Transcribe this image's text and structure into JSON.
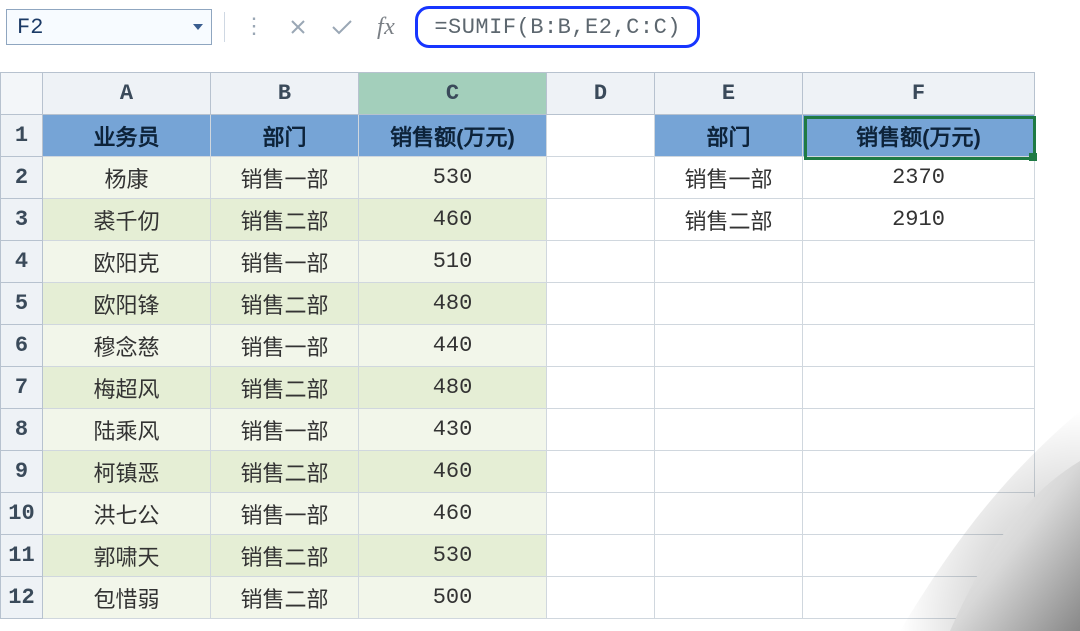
{
  "namebox": {
    "value": "F2"
  },
  "formula_bar": {
    "formula": "=SUMIF(B:B,E2,C:C)"
  },
  "icons": {
    "dropdown": "chevron-down",
    "cancel": "x",
    "confirm": "check",
    "fx": "fx"
  },
  "columns": [
    "A",
    "B",
    "C",
    "D",
    "E",
    "F"
  ],
  "rows": [
    "1",
    "2",
    "3",
    "4",
    "5",
    "6",
    "7",
    "8",
    "9",
    "10",
    "11",
    "12"
  ],
  "headers": {
    "A1": "业务员",
    "B1": "部门",
    "C1": "销售额(万元)",
    "E1": "部门",
    "F1": "销售额(万元)"
  },
  "left_table": [
    {
      "name": "杨康",
      "dept": "销售一部",
      "amount": "530"
    },
    {
      "name": "裘千仞",
      "dept": "销售二部",
      "amount": "460"
    },
    {
      "name": "欧阳克",
      "dept": "销售一部",
      "amount": "510"
    },
    {
      "name": "欧阳锋",
      "dept": "销售二部",
      "amount": "480"
    },
    {
      "name": "穆念慈",
      "dept": "销售一部",
      "amount": "440"
    },
    {
      "name": "梅超风",
      "dept": "销售二部",
      "amount": "480"
    },
    {
      "name": "陆乘风",
      "dept": "销售一部",
      "amount": "430"
    },
    {
      "name": "柯镇恶",
      "dept": "销售二部",
      "amount": "460"
    },
    {
      "name": "洪七公",
      "dept": "销售一部",
      "amount": "460"
    },
    {
      "name": "郭啸天",
      "dept": "销售二部",
      "amount": "530"
    },
    {
      "name": "包惜弱",
      "dept": "销售二部",
      "amount": "500"
    }
  ],
  "right_table": [
    {
      "dept": "销售一部",
      "sum": "2370"
    },
    {
      "dept": "销售二部",
      "sum": "2910"
    }
  ],
  "selection": {
    "cell": "F2"
  },
  "chart_data": {
    "type": "table",
    "left": {
      "columns": [
        "业务员",
        "部门",
        "销售额(万元)"
      ],
      "rows": [
        [
          "杨康",
          "销售一部",
          530
        ],
        [
          "裘千仞",
          "销售二部",
          460
        ],
        [
          "欧阳克",
          "销售一部",
          510
        ],
        [
          "欧阳锋",
          "销售二部",
          480
        ],
        [
          "穆念慈",
          "销售一部",
          440
        ],
        [
          "梅超风",
          "销售二部",
          480
        ],
        [
          "陆乘风",
          "销售一部",
          430
        ],
        [
          "柯镇恶",
          "销售二部",
          460
        ],
        [
          "洪七公",
          "销售一部",
          460
        ],
        [
          "郭啸天",
          "销售二部",
          530
        ],
        [
          "包惜弱",
          "销售二部",
          500
        ]
      ]
    },
    "right": {
      "columns": [
        "部门",
        "销售额(万元)"
      ],
      "rows": [
        [
          "销售一部",
          2370
        ],
        [
          "销售二部",
          2910
        ]
      ]
    }
  }
}
